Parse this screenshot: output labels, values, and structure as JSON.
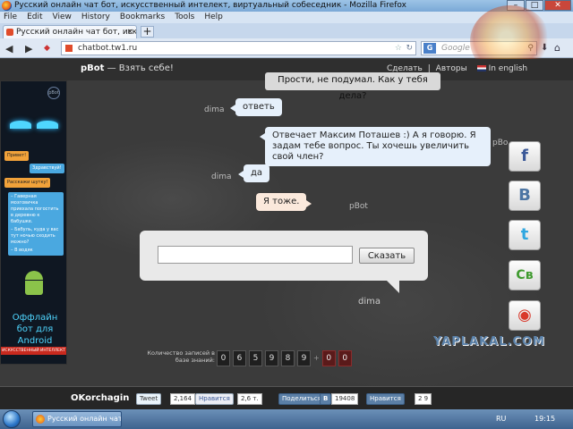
{
  "window": {
    "title": "Русский онлайн чат бот, искусственный интелект, виртуальный собеседник - Mozilla Firefox",
    "min": "–",
    "max": "□",
    "close": "✕"
  },
  "menu": [
    "File",
    "Edit",
    "View",
    "History",
    "Bookmarks",
    "Tools",
    "Help"
  ],
  "tab": {
    "label": "Русский онлайн чат бот, искусственн...",
    "close": "×",
    "new": "+"
  },
  "nav": {
    "back": "◀",
    "forward": "▶",
    "url": "chatbot.tw1.ru",
    "search_placeholder": "Google",
    "search_engine": "G"
  },
  "site": {
    "brand": "pBot",
    "brand_tagline": " — Взять себе!",
    "links": [
      "Сделать",
      "Авторы"
    ],
    "links_sep": "|",
    "english": "In english",
    "tooltip": "Прости, не подумал. Как у тебя дела?"
  },
  "banner": {
    "logo": "pBot",
    "chat1": "Привет!",
    "chat2": "Здравствуй!",
    "chat3": "Расскажи шутку!",
    "chat4": "– Гаверная мозговичка приехала погостить в деревню к бабушке.",
    "chat5": "– Бабуль, куда у вас тут ночью сходить можно?",
    "chat6": "– В водяк",
    "android_text": "Оффлайн бот для Android",
    "footer": "ИСКУССТВЕННЫЙ ИНТЕЛЛЕКТ"
  },
  "chat": {
    "messages": [
      {
        "speaker": "dima",
        "text": "ответь"
      },
      {
        "speaker": "pBo",
        "text": "Отвечает Максим Поташев :) А я говорю. Я задам тебе вопрос. Ты хочешь увеличить свой член?"
      },
      {
        "speaker": "dima",
        "text": "да"
      },
      {
        "speaker": "pBot",
        "text": "Я тоже."
      }
    ],
    "input_value": "",
    "say_button": "Сказать",
    "input_speaker": "dima"
  },
  "counter": {
    "label": "Количество записей в базе знаний:",
    "digits": [
      "0",
      "6",
      "5",
      "9",
      "8",
      "9"
    ],
    "plus": "+",
    "new_digits": [
      "0",
      "0"
    ]
  },
  "social": [
    {
      "name": "facebook",
      "glyph": "f",
      "color": "#3b5998"
    },
    {
      "name": "vkontakte",
      "glyph": "B",
      "color": "#4c75a3"
    },
    {
      "name": "twitter",
      "glyph": "t",
      "color": "#2fa7e0"
    },
    {
      "name": "sv",
      "glyph": "Св",
      "color": "#3f9a2f"
    },
    {
      "name": "chrome",
      "glyph": "◉",
      "color": "#d9382b"
    }
  ],
  "footer": {
    "author": "OKorchagin",
    "tweet": "Tweet",
    "tweet_count": "2,164",
    "fb_like": "Нравится",
    "fb_count": "2,6 т.",
    "share": "Поделиться",
    "vk_count": "19408",
    "vk_like": "Нравится",
    "vk_like_count": "2 9"
  },
  "watermark": "YAPLAKAL.COM",
  "taskbar": {
    "item": "Русский онлайн чат...",
    "lang": "RU",
    "time": "19:15"
  }
}
